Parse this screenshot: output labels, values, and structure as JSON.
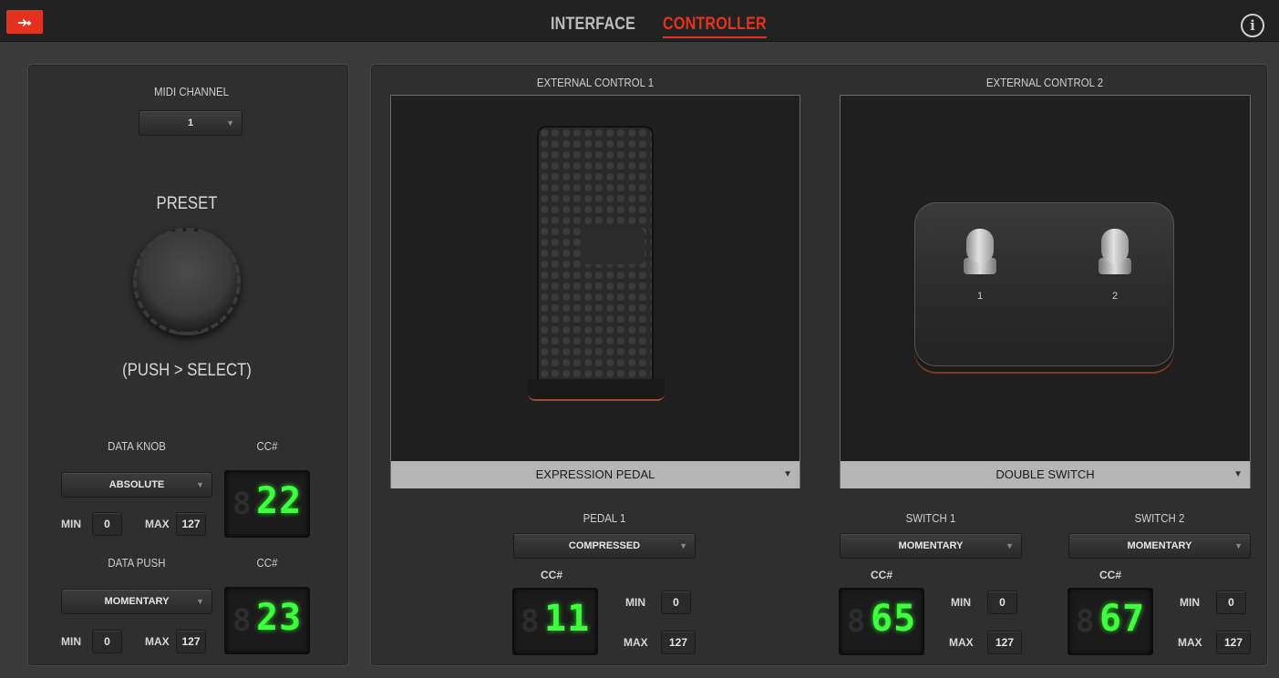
{
  "nav": {
    "tabs": [
      "INTERFACE",
      "CONTROLLER"
    ],
    "active": "CONTROLLER",
    "logo": "⤞",
    "info": "i"
  },
  "left": {
    "midi_channel_label": "MIDI CHANNEL",
    "midi_channel_value": "1",
    "preset_label": "PRESET",
    "preset_hint": "(PUSH > SELECT)",
    "data_knob": {
      "label": "DATA KNOB",
      "cc_label": "CC#",
      "mode": "ABSOLUTE",
      "min_label": "MIN",
      "min": "0",
      "max_label": "MAX",
      "max": "127",
      "cc": "22"
    },
    "data_push": {
      "label": "DATA PUSH",
      "cc_label": "CC#",
      "mode": "MOMENTARY",
      "min_label": "MIN",
      "min": "0",
      "max_label": "MAX",
      "max": "127",
      "cc": "23"
    }
  },
  "ext1": {
    "title": "EXTERNAL CONTROL 1",
    "type": "EXPRESSION PEDAL",
    "pedal": {
      "label": "PEDAL 1",
      "mode": "COMPRESSED",
      "cc_label": "CC#",
      "cc": "11",
      "min_label": "MIN",
      "min": "0",
      "max_label": "MAX",
      "max": "127"
    }
  },
  "ext2": {
    "title": "EXTERNAL CONTROL 2",
    "type": "DOUBLE SWITCH",
    "switch_labels": [
      "1",
      "2"
    ],
    "switch1": {
      "label": "SWITCH 1",
      "mode": "MOMENTARY",
      "cc_label": "CC#",
      "cc": "65",
      "min_label": "MIN",
      "min": "0",
      "max_label": "MAX",
      "max": "127"
    },
    "switch2": {
      "label": "SWITCH 2",
      "mode": "MOMENTARY",
      "cc_label": "CC#",
      "cc": "67",
      "min_label": "MIN",
      "min": "0",
      "max_label": "MAX",
      "max": "127"
    }
  },
  "icons": {
    "dropdown_arrow": "▼"
  },
  "colors": {
    "accent": "#e3321f",
    "lcd_digits": "#3dff3d",
    "panel": "#2f2f2f"
  }
}
